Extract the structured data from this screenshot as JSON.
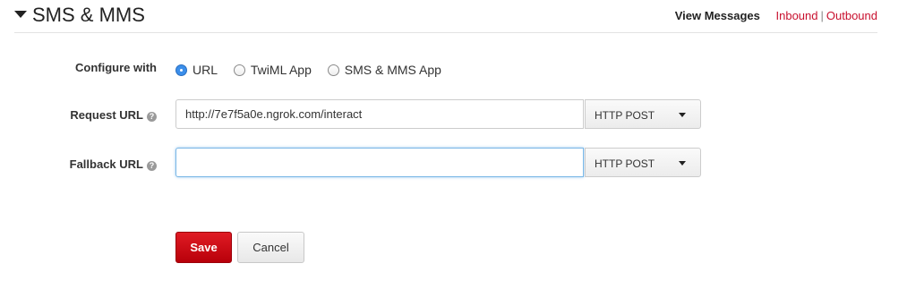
{
  "header": {
    "title": "SMS & MMS",
    "view_messages": "View Messages",
    "inbound": "Inbound",
    "separator": "|",
    "outbound": "Outbound"
  },
  "configure": {
    "label": "Configure with",
    "options": [
      "URL",
      "TwiML App",
      "SMS & MMS App"
    ],
    "selected": "URL"
  },
  "request_url": {
    "label": "Request URL",
    "value": "http://7e7f5a0e.ngrok.com/interact",
    "method": "HTTP POST"
  },
  "fallback_url": {
    "label": "Fallback URL",
    "value": "",
    "method": "HTTP POST"
  },
  "actions": {
    "save": "Save",
    "cancel": "Cancel"
  },
  "colors": {
    "accent_red": "#c8102e",
    "radio_blue": "#3b8eea"
  }
}
